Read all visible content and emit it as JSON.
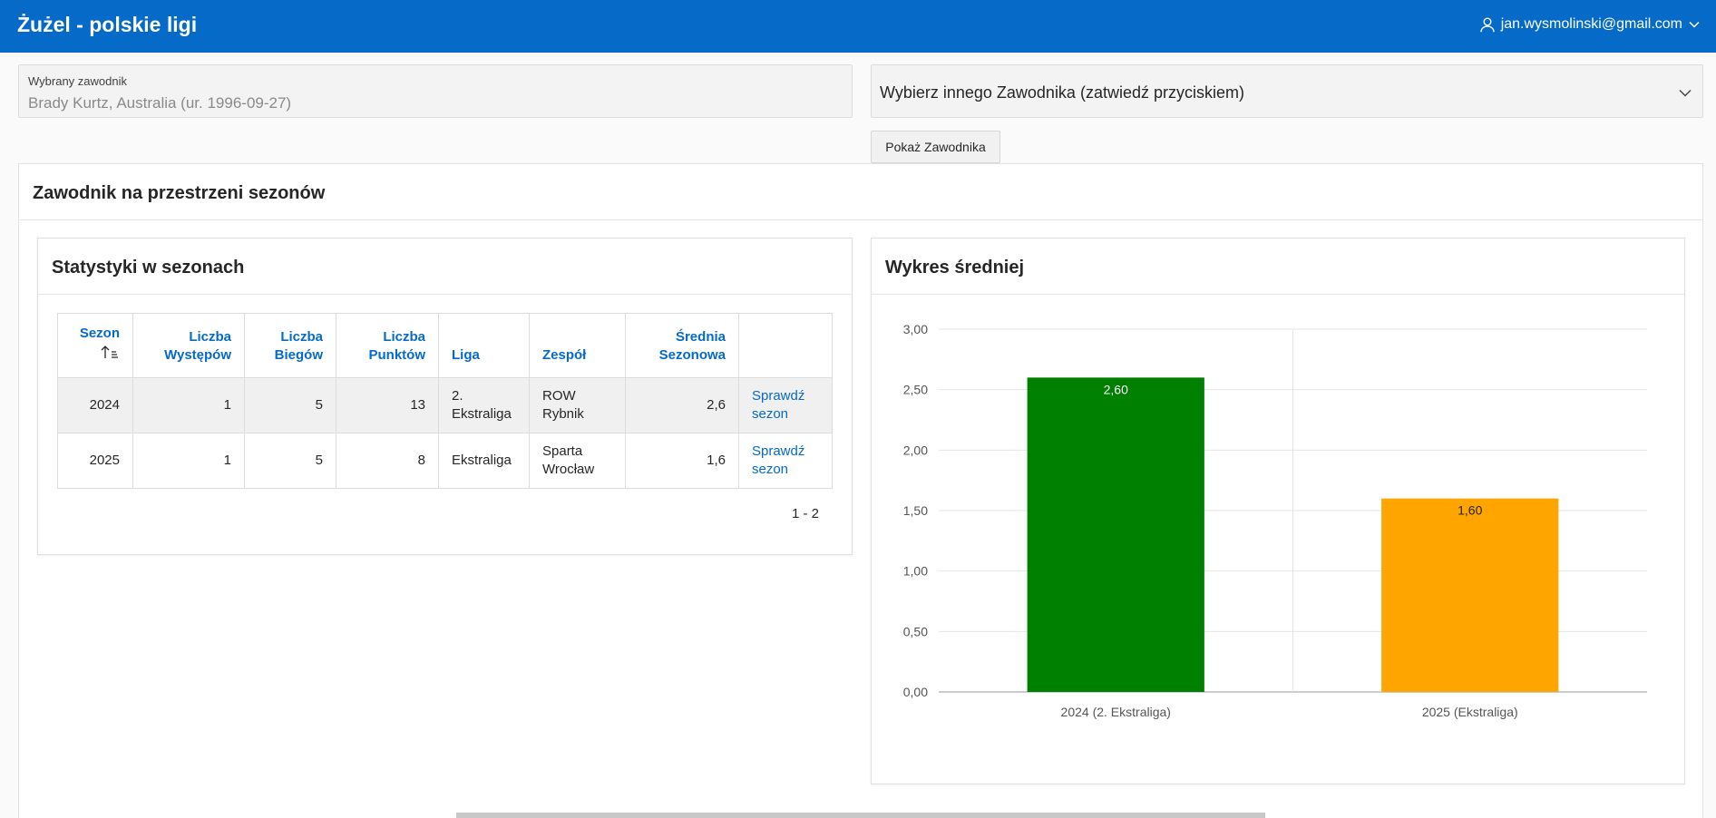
{
  "app": {
    "title": "Żużel - polskie ligi"
  },
  "user": {
    "email": "jan.wysmolinski@gmail.com",
    "icon": "user-icon"
  },
  "selected_player": {
    "label": "Wybrany zawodnik",
    "value": "Brady Kurtz, Australia (ur. 1996-09-27)"
  },
  "player_select": {
    "value": "Wybierz innego Zawodnika (zatwiedź przyciskiem)",
    "button_label": "Pokaż Zawodnika"
  },
  "region": {
    "title": "Zawodnik na przestrzeni sezonów"
  },
  "stats": {
    "title": "Statystyki w sezonach",
    "columns": [
      [
        "Sezon"
      ],
      [
        "Liczba",
        "Występów"
      ],
      [
        "Liczba",
        "Biegów"
      ],
      [
        "Liczba",
        "Punktów"
      ],
      [
        "Liga"
      ],
      [
        "Zespół"
      ],
      [
        "Średnia",
        "Sezonowa"
      ],
      [
        ""
      ]
    ],
    "rows": [
      {
        "sezon": "2024",
        "wystepy": "1",
        "biegi": "5",
        "punkty": "13",
        "liga": [
          "2.",
          "Ekstraliga"
        ],
        "zespol": [
          "ROW",
          "Rybnik"
        ],
        "srednia": "2,6",
        "link": [
          "Sprawdź",
          "sezon"
        ]
      },
      {
        "sezon": "2025",
        "wystepy": "1",
        "biegi": "5",
        "punkty": "8",
        "liga": [
          "Ekstraliga"
        ],
        "zespol": [
          "Sparta",
          "Wrocław"
        ],
        "srednia": "1,6",
        "link": [
          "Sprawdź",
          "sezon"
        ]
      }
    ],
    "pagination": "1 - 2"
  },
  "chart": {
    "title": "Wykres średniej"
  },
  "chart_data": {
    "type": "bar",
    "categories": [
      "2024 (2. Ekstraliga)",
      "2025 (Ekstraliga)"
    ],
    "values": [
      2.6,
      1.6
    ],
    "value_labels": [
      "2,60",
      "1,60"
    ],
    "colors": [
      "#008000",
      "#ffa500"
    ],
    "ylim": [
      0,
      3
    ],
    "yticks": [
      "0,00",
      "0,50",
      "1,00",
      "1,50",
      "2,00",
      "2,50",
      "3,00"
    ],
    "ytick_values": [
      0,
      0.5,
      1,
      1.5,
      2,
      2.5,
      3
    ],
    "grid": true
  }
}
